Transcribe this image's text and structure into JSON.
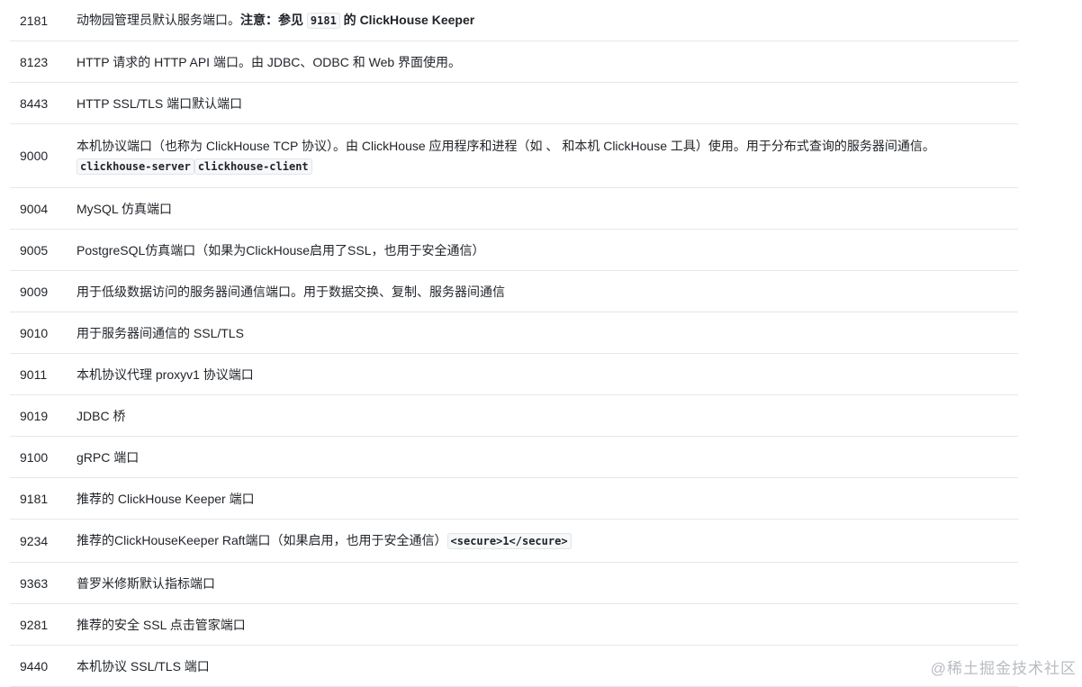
{
  "rows": [
    {
      "port": "2181",
      "parts": [
        {
          "t": "text",
          "v": "动物园管理员默认服务端口。"
        },
        {
          "t": "bold",
          "v": "注意：参见 "
        },
        {
          "t": "code",
          "v": "9181"
        },
        {
          "t": "bold",
          "v": " 的 ClickHouse Keeper"
        }
      ]
    },
    {
      "port": "8123",
      "parts": [
        {
          "t": "text",
          "v": "HTTP 请求的 HTTP API 端口。由 JDBC、ODBC 和 Web 界面使用。"
        }
      ]
    },
    {
      "port": "8443",
      "parts": [
        {
          "t": "text",
          "v": "HTTP SSL/TLS 端口默认端口"
        }
      ]
    },
    {
      "port": "9000",
      "parts": [
        {
          "t": "text",
          "v": "本机协议端口（也称为 ClickHouse TCP 协议）。由 ClickHouse 应用程序和进程（如 、 和本机 ClickHouse 工具）使用。用于分布式查询的服务器间通信。"
        },
        {
          "t": "code",
          "v": "clickhouse-server"
        },
        {
          "t": "code",
          "v": "clickhouse-client"
        }
      ]
    },
    {
      "port": "9004",
      "parts": [
        {
          "t": "text",
          "v": "MySQL 仿真端口"
        }
      ]
    },
    {
      "port": "9005",
      "parts": [
        {
          "t": "text",
          "v": "PostgreSQL仿真端口（如果为ClickHouse启用了SSL，也用于安全通信）"
        }
      ]
    },
    {
      "port": "9009",
      "parts": [
        {
          "t": "text",
          "v": "用于低级数据访问的服务器间通信端口。用于数据交换、复制、服务器间通信"
        }
      ]
    },
    {
      "port": "9010",
      "parts": [
        {
          "t": "text",
          "v": "用于服务器间通信的 SSL/TLS"
        }
      ]
    },
    {
      "port": "9011",
      "parts": [
        {
          "t": "text",
          "v": "本机协议代理 proxyv1 协议端口"
        }
      ]
    },
    {
      "port": "9019",
      "parts": [
        {
          "t": "text",
          "v": "JDBC 桥"
        }
      ]
    },
    {
      "port": "9100",
      "parts": [
        {
          "t": "text",
          "v": "gRPC 端口"
        }
      ]
    },
    {
      "port": "9181",
      "parts": [
        {
          "t": "text",
          "v": "推荐的 ClickHouse Keeper 端口"
        }
      ]
    },
    {
      "port": "9234",
      "parts": [
        {
          "t": "text",
          "v": "推荐的ClickHouseKeeper Raft端口（如果启用，也用于安全通信）"
        },
        {
          "t": "code",
          "v": "<secure>1</secure>"
        }
      ]
    },
    {
      "port": "9363",
      "parts": [
        {
          "t": "text",
          "v": "普罗米修斯默认指标端口"
        }
      ]
    },
    {
      "port": "9281",
      "parts": [
        {
          "t": "text",
          "v": "推荐的安全 SSL 点击管家端口"
        }
      ]
    },
    {
      "port": "9440",
      "parts": [
        {
          "t": "text",
          "v": "本机协议 SSL/TLS 端口"
        }
      ]
    }
  ],
  "watermark": "@稀土掘金技术社区"
}
